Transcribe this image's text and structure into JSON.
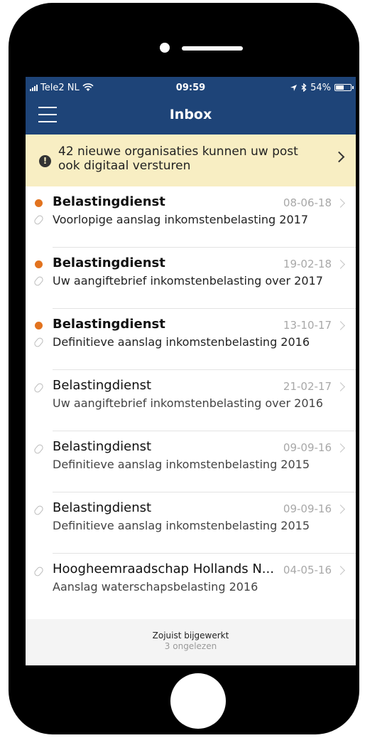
{
  "status_bar": {
    "carrier": "Tele2 NL",
    "time": "09:59",
    "battery": "54%",
    "battery_level": 0.54
  },
  "nav": {
    "title": "Inbox"
  },
  "banner": {
    "text": "42 nieuwe organisaties kunnen uw post ook digitaal versturen"
  },
  "messages": [
    {
      "sender": "Belastingdienst",
      "subject": "Voorlopige aanslag inkomstenbelasting 2017",
      "date": "08-06-18",
      "unread": true
    },
    {
      "sender": "Belastingdienst",
      "subject": "Uw aangiftebrief inkomstenbelasting  over 2017",
      "date": "19-02-18",
      "unread": true
    },
    {
      "sender": "Belastingdienst",
      "subject": "Definitieve aanslag inkomstenbelasting 2016",
      "date": "13-10-17",
      "unread": true
    },
    {
      "sender": "Belastingdienst",
      "subject": "Uw aangiftebrief inkomstenbelasting  over 2016",
      "date": "21-02-17",
      "unread": false
    },
    {
      "sender": "Belastingdienst",
      "subject": "Definitieve aanslag inkomstenbelasting 2015",
      "date": "09-09-16",
      "unread": false
    },
    {
      "sender": "Belastingdienst",
      "subject": "Definitieve aanslag inkomstenbelasting 2015",
      "date": "09-09-16",
      "unread": false
    },
    {
      "sender": "Hoogheemraadschap Hollands N...",
      "subject": "Aanslag waterschapsbelasting 2016",
      "date": "04-05-16",
      "unread": false
    }
  ],
  "footer": {
    "updated": "Zojuist bijgewerkt",
    "unread_count": "3 ongelezen"
  },
  "colors": {
    "nav_background": "#1e4478",
    "banner_background": "#f8eec3",
    "unread_dot": "#e2731f"
  },
  "icons": {
    "menu": "hamburger-icon",
    "warning": "exclamation-circle-icon",
    "attachment": "paperclip-icon",
    "chevron": "chevron-right-icon"
  }
}
